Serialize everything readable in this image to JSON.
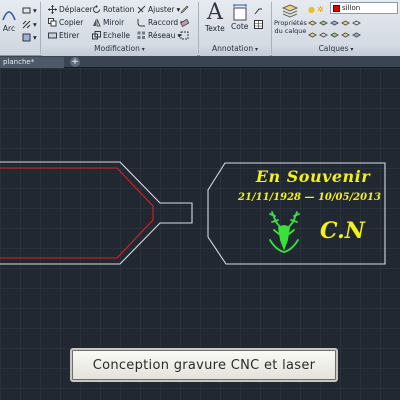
{
  "ribbon": {
    "arc": "Arc",
    "modify": {
      "title": "Modification",
      "commands": [
        "Déplacer",
        "Rotation",
        "Ajuster",
        "Copier",
        "Miroir",
        "Raccord",
        "Etirer",
        "Echelle",
        "Réseau"
      ]
    },
    "annotation": {
      "title": "Annotation",
      "texte": "Texte",
      "cote": "Cote"
    },
    "properties": {
      "label_line1": "Propriétés",
      "label_line2": "du calque"
    },
    "layers": {
      "title": "Calques",
      "current_layer": "sillon",
      "current_layer_color": "#e00000"
    }
  },
  "tabs": {
    "active": "planche*",
    "add": "+"
  },
  "drawing": {
    "line1": "En Souvenir",
    "line2": "21/11/1928  —  10/05/2013",
    "initials": "C.N",
    "text_color": "#f2f21a",
    "emblem_color": "#39e23a"
  },
  "caption": "Conception gravure CNC et laser"
}
